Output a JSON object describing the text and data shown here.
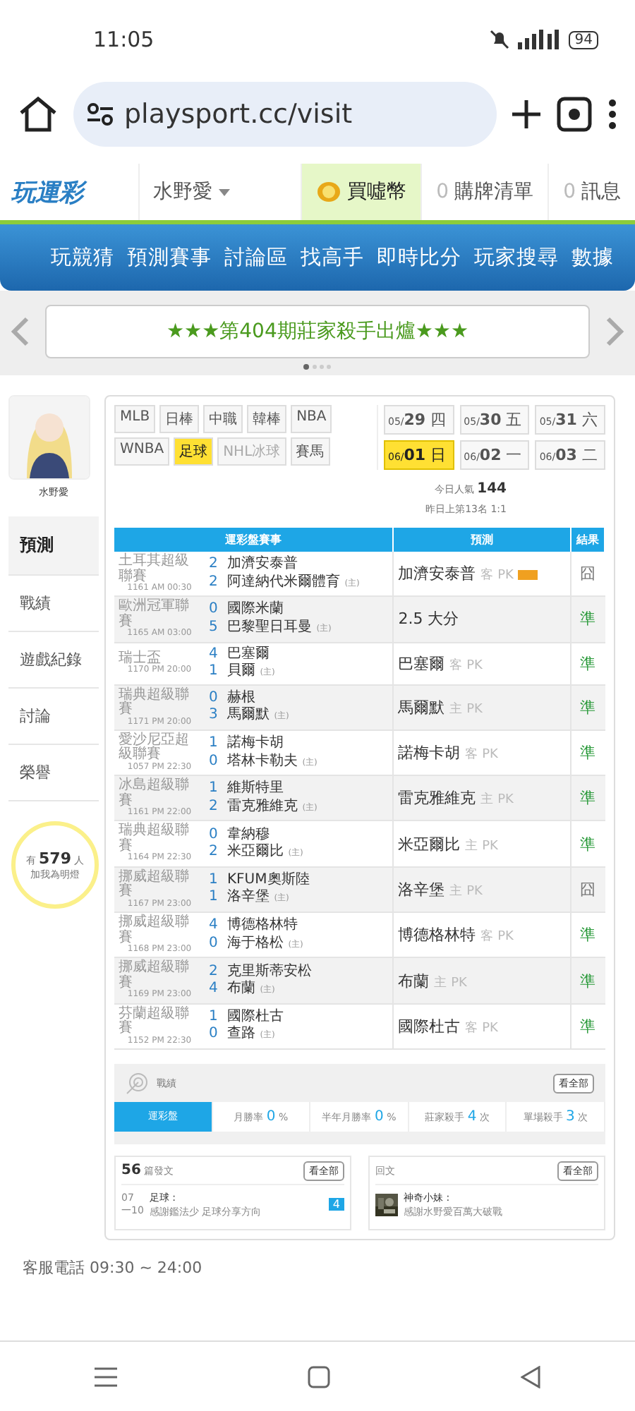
{
  "status_bar": {
    "time": "11:05",
    "battery": "94"
  },
  "browser": {
    "url": "playsport.cc/visit"
  },
  "site_header": {
    "logo": "玩運彩",
    "user_menu": "水野愛",
    "buy_coins": "買噓幣",
    "cart": {
      "count": "0",
      "label": "購牌清單"
    },
    "messages": {
      "count": "0",
      "label": "訊息"
    }
  },
  "nav": [
    "玩競猜",
    "預測賽事",
    "討論區",
    "找高手",
    "即時比分",
    "玩家搜尋",
    "數據"
  ],
  "banner": {
    "text": "★★★第404期莊家殺手出爐★★★"
  },
  "profile": {
    "name": "水野愛"
  },
  "side_menu": [
    {
      "label": "預測",
      "selected": true
    },
    {
      "label": "戰績",
      "selected": false
    },
    {
      "label": "遊戲紀錄",
      "selected": false
    },
    {
      "label": "討論",
      "selected": false
    },
    {
      "label": "榮譽",
      "selected": false
    }
  ],
  "fans": {
    "prefix": "有",
    "count": "579",
    "suffix": "人",
    "caption": "加我為明燈"
  },
  "sports": [
    {
      "label": "MLB",
      "selected": false,
      "disabled": false
    },
    {
      "label": "日棒",
      "selected": false,
      "disabled": false
    },
    {
      "label": "中職",
      "selected": false,
      "disabled": false
    },
    {
      "label": "韓棒",
      "selected": false,
      "disabled": false
    },
    {
      "label": "NBA",
      "selected": false,
      "disabled": false
    },
    {
      "label": "WNBA",
      "selected": false,
      "disabled": false
    },
    {
      "label": "足球",
      "selected": true,
      "disabled": false
    },
    {
      "label": "NHL冰球",
      "selected": false,
      "disabled": true
    },
    {
      "label": "賽馬",
      "selected": false,
      "disabled": false
    }
  ],
  "dates": [
    {
      "month": "05/",
      "day": "29",
      "weekday": "四",
      "selected": false
    },
    {
      "month": "05/",
      "day": "30",
      "weekday": "五",
      "selected": false
    },
    {
      "month": "05/",
      "day": "31",
      "weekday": "六",
      "selected": false
    },
    {
      "month": "06/",
      "day": "01",
      "weekday": "日",
      "selected": true
    },
    {
      "month": "06/",
      "day": "02",
      "weekday": "一",
      "selected": false
    },
    {
      "month": "06/",
      "day": "03",
      "weekday": "二",
      "selected": false
    }
  ],
  "popularity": {
    "label": "今日人氣",
    "value": "144",
    "rank": "昨日上第13名 1:1"
  },
  "table": {
    "columns": [
      "運彩盤賽事",
      "預測",
      "結果"
    ],
    "rows": [
      {
        "league": "土耳其超級聯賽",
        "code": "1161",
        "time": "AM 00:30",
        "teams": [
          {
            "score": "2",
            "name": "加濟安泰普"
          },
          {
            "score": "2",
            "name": "阿達納代米爾體育",
            "note": "(主)"
          }
        ],
        "pick": "加濟安泰普",
        "side": "客 PK",
        "badge": true,
        "result": "囧",
        "correct": false
      },
      {
        "league": "歐洲冠軍聯賽",
        "code": "1165",
        "time": "AM 03:00",
        "teams": [
          {
            "score": "0",
            "name": "國際米蘭"
          },
          {
            "score": "5",
            "name": "巴黎聖日耳曼",
            "note": "(主)"
          }
        ],
        "pick": "2.5 大分",
        "badge": false,
        "result": "準",
        "correct": true
      },
      {
        "league": "瑞士盃",
        "code": "1170",
        "time": "PM 20:00",
        "teams": [
          {
            "score": "4",
            "name": "巴塞爾"
          },
          {
            "score": "1",
            "name": "貝爾",
            "note": "(主)"
          }
        ],
        "pick": "巴塞爾",
        "side": "客 PK",
        "badge": false,
        "result": "準",
        "correct": true
      },
      {
        "league": "瑞典超級聯賽",
        "code": "1171",
        "time": "PM 20:00",
        "teams": [
          {
            "score": "0",
            "name": "赫根"
          },
          {
            "score": "3",
            "name": "馬爾默",
            "note": "(主)"
          }
        ],
        "pick": "馬爾默",
        "side": "主 PK",
        "badge": false,
        "result": "準",
        "correct": true
      },
      {
        "league": "愛沙尼亞超級聯賽",
        "code": "1057",
        "time": "PM 22:30",
        "teams": [
          {
            "score": "1",
            "name": "諾梅卡胡"
          },
          {
            "score": "0",
            "name": "塔林卡勒夫",
            "note": "(主)"
          }
        ],
        "pick": "諾梅卡胡",
        "side": "客 PK",
        "badge": false,
        "result": "準",
        "correct": true
      },
      {
        "league": "冰島超級聯賽",
        "code": "1161",
        "time": "PM 22:00",
        "teams": [
          {
            "score": "1",
            "name": "維斯特里"
          },
          {
            "score": "2",
            "name": "雷克雅維克",
            "note": "(主)"
          }
        ],
        "pick": "雷克雅維克",
        "side": "主 PK",
        "badge": false,
        "result": "準",
        "correct": true
      },
      {
        "league": "瑞典超級聯賽",
        "code": "1164",
        "time": "PM 22:30",
        "teams": [
          {
            "score": "0",
            "name": "韋納穆"
          },
          {
            "score": "2",
            "name": "米亞爾比",
            "note": "(主)"
          }
        ],
        "pick": "米亞爾比",
        "side": "主 PK",
        "badge": false,
        "result": "準",
        "correct": true
      },
      {
        "league": "挪威超級聯賽",
        "code": "1167",
        "time": "PM 23:00",
        "teams": [
          {
            "score": "1",
            "name": "KFUM奧斯陸"
          },
          {
            "score": "1",
            "name": "洛辛堡",
            "note": "(主)"
          }
        ],
        "pick": "洛辛堡",
        "side": "主 PK",
        "badge": false,
        "result": "囧",
        "correct": false
      },
      {
        "league": "挪威超級聯賽",
        "code": "1168",
        "time": "PM 23:00",
        "teams": [
          {
            "score": "4",
            "name": "博德格林特"
          },
          {
            "score": "0",
            "name": "海于格松",
            "note": "(主)"
          }
        ],
        "pick": "博德格林特",
        "side": "客 PK",
        "badge": false,
        "result": "準",
        "correct": true
      },
      {
        "league": "挪威超級聯賽",
        "code": "1169",
        "time": "PM 23:00",
        "teams": [
          {
            "score": "2",
            "name": "克里斯蒂安松"
          },
          {
            "score": "4",
            "name": "布蘭",
            "note": "(主)"
          }
        ],
        "pick": "布蘭",
        "side": "主 PK",
        "badge": false,
        "result": "準",
        "correct": true
      },
      {
        "league": "芬蘭超級聯賽",
        "code": "1152",
        "time": "PM 22:30",
        "teams": [
          {
            "score": "1",
            "name": "國際杜古"
          },
          {
            "score": "0",
            "name": "查路",
            "note": "(主)"
          }
        ],
        "pick": "國際杜古",
        "side": "客 PK",
        "badge": false,
        "result": "準",
        "correct": true
      }
    ]
  },
  "record": {
    "title": "戰績",
    "view_all": "看全部",
    "tabs": [
      {
        "label": "運彩盤",
        "selected": true
      },
      {
        "label": "月勝率",
        "value": "0",
        "unit": "%",
        "selected": false
      },
      {
        "label": "半年月勝率",
        "value": "0",
        "unit": "%",
        "selected": false
      },
      {
        "label": "莊家殺手",
        "value": "4",
        "unit": "次",
        "selected": false
      },
      {
        "label": "單場殺手",
        "value": "3",
        "unit": "次",
        "selected": false
      }
    ]
  },
  "posts": {
    "count": "56",
    "label": "篇發文",
    "view_all": "看全部",
    "item": {
      "day": "07",
      "sub": "一10",
      "tag": "足球 :",
      "text": "感謝鑑法少 足球分享方向",
      "replies": "4"
    }
  },
  "replies": {
    "title": "回文",
    "view_all": "看全部",
    "item": {
      "author": "神奇小妹 :",
      "text": "感謝水野愛百萬大破戰"
    }
  },
  "footer": {
    "service": "客服電話 09:30 ~ 24:00"
  }
}
